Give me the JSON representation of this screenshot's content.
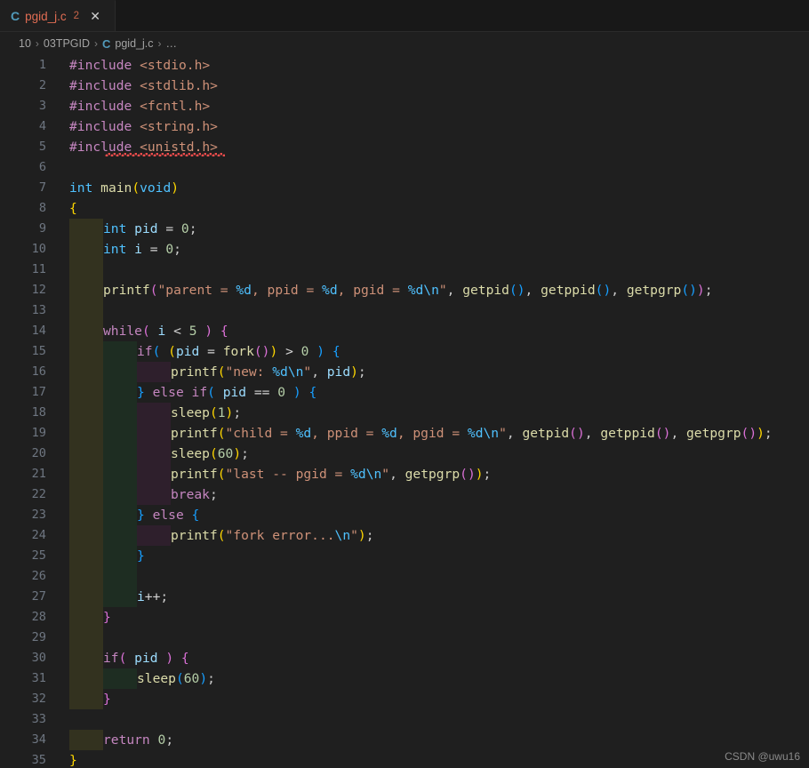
{
  "window": {
    "background_color": "#1f1f1f",
    "tabbar_color": "#181818"
  },
  "tab": {
    "icon": "c-file-icon",
    "icon_glyph": "C",
    "filename": "pgid_j.c",
    "problem_count": "2",
    "close_glyph": "✕",
    "filename_color": "#e06c53"
  },
  "breadcrumb": {
    "items": [
      {
        "label": "10",
        "icon": null
      },
      {
        "label": "03TPGID",
        "icon": null
      },
      {
        "label": "pgid_j.c",
        "icon": "c-file-icon",
        "icon_glyph": "C"
      },
      {
        "label": "…",
        "icon": null
      }
    ],
    "separator": "›"
  },
  "editor": {
    "language": "c",
    "error_squiggle_line": 5,
    "first_visible_line": 1,
    "last_visible_line": 35,
    "indent_guide_colors": [
      "#33321f",
      "#1e2d22",
      "#2e1f2c"
    ],
    "lines": [
      {
        "n": "1",
        "guides": 0,
        "tokens": [
          {
            "t": "#include ",
            "c": "pre"
          },
          {
            "t": "<stdio.h>",
            "c": "hdr"
          }
        ]
      },
      {
        "n": "2",
        "guides": 0,
        "tokens": [
          {
            "t": "#include ",
            "c": "pre"
          },
          {
            "t": "<stdlib.h>",
            "c": "hdr"
          }
        ]
      },
      {
        "n": "3",
        "guides": 0,
        "tokens": [
          {
            "t": "#include ",
            "c": "pre"
          },
          {
            "t": "<fcntl.h>",
            "c": "hdr"
          }
        ]
      },
      {
        "n": "4",
        "guides": 0,
        "tokens": [
          {
            "t": "#include ",
            "c": "pre"
          },
          {
            "t": "<string.h>",
            "c": "hdr"
          }
        ]
      },
      {
        "n": "5",
        "guides": 0,
        "tokens": [
          {
            "t": "#include ",
            "c": "pre"
          },
          {
            "t": "<unistd.h>",
            "c": "hdr"
          }
        ]
      },
      {
        "n": "6",
        "guides": 0,
        "tokens": []
      },
      {
        "n": "7",
        "guides": 0,
        "tokens": [
          {
            "t": "int",
            "c": "type"
          },
          {
            "t": " ",
            "c": "punc"
          },
          {
            "t": "main",
            "c": "fn"
          },
          {
            "t": "(",
            "c": "by"
          },
          {
            "t": "void",
            "c": "type"
          },
          {
            "t": ")",
            "c": "by"
          }
        ]
      },
      {
        "n": "8",
        "guides": 0,
        "tokens": [
          {
            "t": "{",
            "c": "by"
          }
        ]
      },
      {
        "n": "9",
        "guides": 1,
        "tokens": [
          {
            "t": "int",
            "c": "type"
          },
          {
            "t": " ",
            "c": "punc"
          },
          {
            "t": "pid",
            "c": "var"
          },
          {
            "t": " ",
            "c": "punc"
          },
          {
            "t": "=",
            "c": "op"
          },
          {
            "t": " ",
            "c": "punc"
          },
          {
            "t": "0",
            "c": "num"
          },
          {
            "t": ";",
            "c": "punc"
          }
        ]
      },
      {
        "n": "10",
        "guides": 1,
        "tokens": [
          {
            "t": "int",
            "c": "type"
          },
          {
            "t": " ",
            "c": "punc"
          },
          {
            "t": "i",
            "c": "var"
          },
          {
            "t": " ",
            "c": "punc"
          },
          {
            "t": "=",
            "c": "op"
          },
          {
            "t": " ",
            "c": "punc"
          },
          {
            "t": "0",
            "c": "num"
          },
          {
            "t": ";",
            "c": "punc"
          }
        ]
      },
      {
        "n": "11",
        "guides": 1,
        "tokens": []
      },
      {
        "n": "12",
        "guides": 1,
        "tokens": [
          {
            "t": "printf",
            "c": "fn"
          },
          {
            "t": "(",
            "c": "bp"
          },
          {
            "t": "\"parent = ",
            "c": "str"
          },
          {
            "t": "%d",
            "c": "fmt"
          },
          {
            "t": ", ppid = ",
            "c": "str"
          },
          {
            "t": "%d",
            "c": "fmt"
          },
          {
            "t": ", pgid = ",
            "c": "str"
          },
          {
            "t": "%d",
            "c": "fmt"
          },
          {
            "t": "\\n",
            "c": "fmt"
          },
          {
            "t": "\"",
            "c": "str"
          },
          {
            "t": ", ",
            "c": "punc"
          },
          {
            "t": "getpid",
            "c": "fn"
          },
          {
            "t": "(",
            "c": "bb"
          },
          {
            "t": ")",
            "c": "bb"
          },
          {
            "t": ", ",
            "c": "punc"
          },
          {
            "t": "getppid",
            "c": "fn"
          },
          {
            "t": "(",
            "c": "bb"
          },
          {
            "t": ")",
            "c": "bb"
          },
          {
            "t": ", ",
            "c": "punc"
          },
          {
            "t": "getpgrp",
            "c": "fn"
          },
          {
            "t": "(",
            "c": "bb"
          },
          {
            "t": ")",
            "c": "bb"
          },
          {
            "t": ")",
            "c": "bp"
          },
          {
            "t": ";",
            "c": "punc"
          }
        ]
      },
      {
        "n": "13",
        "guides": 1,
        "tokens": []
      },
      {
        "n": "14",
        "guides": 1,
        "tokens": [
          {
            "t": "while",
            "c": "kw"
          },
          {
            "t": "(",
            "c": "bp"
          },
          {
            "t": " ",
            "c": "punc"
          },
          {
            "t": "i",
            "c": "var"
          },
          {
            "t": " ",
            "c": "punc"
          },
          {
            "t": "<",
            "c": "op"
          },
          {
            "t": " ",
            "c": "punc"
          },
          {
            "t": "5",
            "c": "num"
          },
          {
            "t": " ",
            "c": "punc"
          },
          {
            "t": ")",
            "c": "bp"
          },
          {
            "t": " ",
            "c": "punc"
          },
          {
            "t": "{",
            "c": "bp"
          }
        ]
      },
      {
        "n": "15",
        "guides": 2,
        "tokens": [
          {
            "t": "if",
            "c": "kw"
          },
          {
            "t": "(",
            "c": "bb"
          },
          {
            "t": " ",
            "c": "punc"
          },
          {
            "t": "(",
            "c": "by"
          },
          {
            "t": "pid",
            "c": "var"
          },
          {
            "t": " ",
            "c": "punc"
          },
          {
            "t": "=",
            "c": "op"
          },
          {
            "t": " ",
            "c": "punc"
          },
          {
            "t": "fork",
            "c": "fn"
          },
          {
            "t": "(",
            "c": "bp"
          },
          {
            "t": ")",
            "c": "bp"
          },
          {
            "t": ")",
            "c": "by"
          },
          {
            "t": " ",
            "c": "punc"
          },
          {
            "t": ">",
            "c": "op"
          },
          {
            "t": " ",
            "c": "punc"
          },
          {
            "t": "0",
            "c": "num"
          },
          {
            "t": " ",
            "c": "punc"
          },
          {
            "t": ")",
            "c": "bb"
          },
          {
            "t": " ",
            "c": "punc"
          },
          {
            "t": "{",
            "c": "bb"
          }
        ]
      },
      {
        "n": "16",
        "guides": 3,
        "tokens": [
          {
            "t": "printf",
            "c": "fn"
          },
          {
            "t": "(",
            "c": "by"
          },
          {
            "t": "\"new: ",
            "c": "str"
          },
          {
            "t": "%d",
            "c": "fmt"
          },
          {
            "t": "\\n",
            "c": "fmt"
          },
          {
            "t": "\"",
            "c": "str"
          },
          {
            "t": ", ",
            "c": "punc"
          },
          {
            "t": "pid",
            "c": "var"
          },
          {
            "t": ")",
            "c": "by"
          },
          {
            "t": ";",
            "c": "punc"
          }
        ]
      },
      {
        "n": "17",
        "guides": 2,
        "tokens": [
          {
            "t": "}",
            "c": "bb"
          },
          {
            "t": " ",
            "c": "punc"
          },
          {
            "t": "else",
            "c": "kw"
          },
          {
            "t": " ",
            "c": "punc"
          },
          {
            "t": "if",
            "c": "kw"
          },
          {
            "t": "(",
            "c": "bb"
          },
          {
            "t": " ",
            "c": "punc"
          },
          {
            "t": "pid",
            "c": "var"
          },
          {
            "t": " ",
            "c": "punc"
          },
          {
            "t": "==",
            "c": "op"
          },
          {
            "t": " ",
            "c": "punc"
          },
          {
            "t": "0",
            "c": "num"
          },
          {
            "t": " ",
            "c": "punc"
          },
          {
            "t": ")",
            "c": "bb"
          },
          {
            "t": " ",
            "c": "punc"
          },
          {
            "t": "{",
            "c": "bb"
          }
        ]
      },
      {
        "n": "18",
        "guides": 3,
        "tokens": [
          {
            "t": "sleep",
            "c": "fn"
          },
          {
            "t": "(",
            "c": "by"
          },
          {
            "t": "1",
            "c": "num"
          },
          {
            "t": ")",
            "c": "by"
          },
          {
            "t": ";",
            "c": "punc"
          }
        ]
      },
      {
        "n": "19",
        "guides": 3,
        "tokens": [
          {
            "t": "printf",
            "c": "fn"
          },
          {
            "t": "(",
            "c": "by"
          },
          {
            "t": "\"child = ",
            "c": "str"
          },
          {
            "t": "%d",
            "c": "fmt"
          },
          {
            "t": ", ppid = ",
            "c": "str"
          },
          {
            "t": "%d",
            "c": "fmt"
          },
          {
            "t": ", pgid = ",
            "c": "str"
          },
          {
            "t": "%d",
            "c": "fmt"
          },
          {
            "t": "\\n",
            "c": "fmt"
          },
          {
            "t": "\"",
            "c": "str"
          },
          {
            "t": ", ",
            "c": "punc"
          },
          {
            "t": "getpid",
            "c": "fn"
          },
          {
            "t": "(",
            "c": "bp"
          },
          {
            "t": ")",
            "c": "bp"
          },
          {
            "t": ", ",
            "c": "punc"
          },
          {
            "t": "getppid",
            "c": "fn"
          },
          {
            "t": "(",
            "c": "bp"
          },
          {
            "t": ")",
            "c": "bp"
          },
          {
            "t": ", ",
            "c": "punc"
          },
          {
            "t": "getpgrp",
            "c": "fn"
          },
          {
            "t": "(",
            "c": "bp"
          },
          {
            "t": ")",
            "c": "bp"
          },
          {
            "t": ")",
            "c": "by"
          },
          {
            "t": ";",
            "c": "punc"
          }
        ]
      },
      {
        "n": "20",
        "guides": 3,
        "tokens": [
          {
            "t": "sleep",
            "c": "fn"
          },
          {
            "t": "(",
            "c": "by"
          },
          {
            "t": "60",
            "c": "num"
          },
          {
            "t": ")",
            "c": "by"
          },
          {
            "t": ";",
            "c": "punc"
          }
        ]
      },
      {
        "n": "21",
        "guides": 3,
        "tokens": [
          {
            "t": "printf",
            "c": "fn"
          },
          {
            "t": "(",
            "c": "by"
          },
          {
            "t": "\"last -- pgid = ",
            "c": "str"
          },
          {
            "t": "%d",
            "c": "fmt"
          },
          {
            "t": "\\n",
            "c": "fmt"
          },
          {
            "t": "\"",
            "c": "str"
          },
          {
            "t": ", ",
            "c": "punc"
          },
          {
            "t": "getpgrp",
            "c": "fn"
          },
          {
            "t": "(",
            "c": "bp"
          },
          {
            "t": ")",
            "c": "bp"
          },
          {
            "t": ")",
            "c": "by"
          },
          {
            "t": ";",
            "c": "punc"
          }
        ]
      },
      {
        "n": "22",
        "guides": 3,
        "tokens": [
          {
            "t": "break",
            "c": "kw"
          },
          {
            "t": ";",
            "c": "punc"
          }
        ]
      },
      {
        "n": "23",
        "guides": 2,
        "tokens": [
          {
            "t": "}",
            "c": "bb"
          },
          {
            "t": " ",
            "c": "punc"
          },
          {
            "t": "else",
            "c": "kw"
          },
          {
            "t": " ",
            "c": "punc"
          },
          {
            "t": "{",
            "c": "bb"
          }
        ]
      },
      {
        "n": "24",
        "guides": 3,
        "tokens": [
          {
            "t": "printf",
            "c": "fn"
          },
          {
            "t": "(",
            "c": "by"
          },
          {
            "t": "\"fork error...",
            "c": "str"
          },
          {
            "t": "\\n",
            "c": "fmt"
          },
          {
            "t": "\"",
            "c": "str"
          },
          {
            "t": ")",
            "c": "by"
          },
          {
            "t": ";",
            "c": "punc"
          }
        ]
      },
      {
        "n": "25",
        "guides": 2,
        "tokens": [
          {
            "t": "}",
            "c": "bb"
          }
        ]
      },
      {
        "n": "26",
        "guides": 2,
        "tokens": []
      },
      {
        "n": "27",
        "guides": 2,
        "tokens": [
          {
            "t": "i",
            "c": "var"
          },
          {
            "t": "++",
            "c": "op"
          },
          {
            "t": ";",
            "c": "punc"
          }
        ]
      },
      {
        "n": "28",
        "guides": 1,
        "tokens": [
          {
            "t": "}",
            "c": "bp"
          }
        ]
      },
      {
        "n": "29",
        "guides": 1,
        "tokens": []
      },
      {
        "n": "30",
        "guides": 1,
        "tokens": [
          {
            "t": "if",
            "c": "kw"
          },
          {
            "t": "(",
            "c": "bp"
          },
          {
            "t": " ",
            "c": "punc"
          },
          {
            "t": "pid",
            "c": "var"
          },
          {
            "t": " ",
            "c": "punc"
          },
          {
            "t": ")",
            "c": "bp"
          },
          {
            "t": " ",
            "c": "punc"
          },
          {
            "t": "{",
            "c": "bp"
          }
        ]
      },
      {
        "n": "31",
        "guides": 2,
        "tokens": [
          {
            "t": "sleep",
            "c": "fn"
          },
          {
            "t": "(",
            "c": "bb"
          },
          {
            "t": "60",
            "c": "num"
          },
          {
            "t": ")",
            "c": "bb"
          },
          {
            "t": ";",
            "c": "punc"
          }
        ]
      },
      {
        "n": "32",
        "guides": 1,
        "tokens": [
          {
            "t": "}",
            "c": "bp"
          }
        ]
      },
      {
        "n": "33",
        "guides": 0,
        "tokens": []
      },
      {
        "n": "34",
        "guides": 1,
        "tokens": [
          {
            "t": "return",
            "c": "kw"
          },
          {
            "t": " ",
            "c": "punc"
          },
          {
            "t": "0",
            "c": "num"
          },
          {
            "t": ";",
            "c": "punc"
          }
        ]
      },
      {
        "n": "35",
        "guides": 0,
        "tokens": [
          {
            "t": "}",
            "c": "by"
          }
        ]
      }
    ]
  },
  "watermark": {
    "text": "CSDN @uwu16"
  }
}
